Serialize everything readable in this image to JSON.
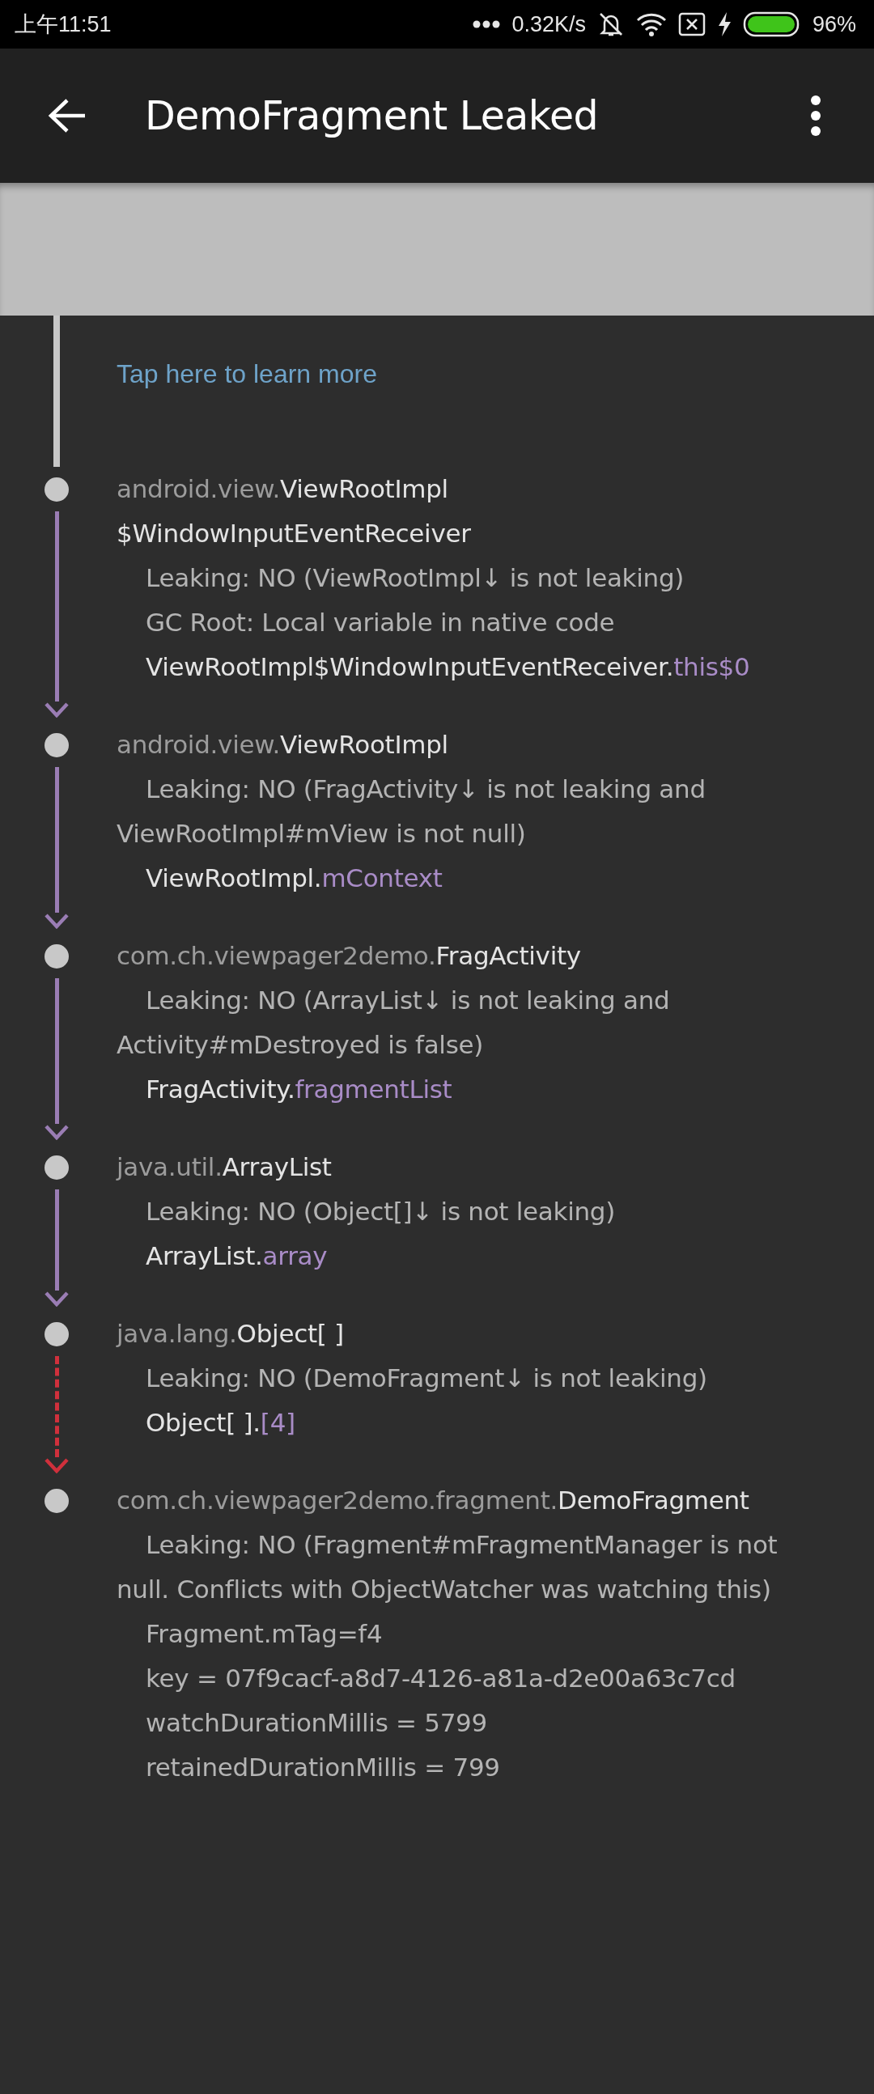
{
  "status_bar": {
    "time": "上午11:51",
    "network_speed": "0.32K/s",
    "battery_percent": "96%"
  },
  "app_bar": {
    "title": "DemoFragment Leaked"
  },
  "learn_more_link": "Tap here to learn more",
  "leak_trace": [
    {
      "arrow": {
        "kind": "reference"
      },
      "rows": [
        {
          "kind": "header",
          "segments": [
            {
              "text": "android.view.",
              "kind": "package"
            },
            {
              "text": "ViewRootImpl",
              "kind": "class"
            },
            {
              "text": "$WindowInputEventReceiver",
              "kind": "class"
            }
          ]
        },
        {
          "kind": "detail",
          "segments": [
            {
              "text": "Leaking: NO (ViewRootImpl↓  is not leaking)",
              "kind": "detail"
            }
          ]
        },
        {
          "kind": "detail",
          "segments": [
            {
              "text": "GC Root: Local variable in native code",
              "kind": "detail"
            }
          ]
        },
        {
          "kind": "reference",
          "segments": [
            {
              "text": "ViewRootImpl",
              "kind": "class"
            },
            {
              "text": "$WindowInputEventReceiver.",
              "kind": "class"
            },
            {
              "text": "this$0",
              "kind": "field"
            }
          ]
        }
      ]
    },
    {
      "arrow": {
        "kind": "reference"
      },
      "rows": [
        {
          "kind": "header",
          "segments": [
            {
              "text": "android.view.",
              "kind": "package"
            },
            {
              "text": "ViewRootImpl",
              "kind": "class"
            }
          ]
        },
        {
          "kind": "detail",
          "segments": [
            {
              "text": "Leaking: NO (FragActivity↓  is not leaking and ViewRootImpl#mView is not null)",
              "kind": "detail"
            }
          ]
        },
        {
          "kind": "reference",
          "segments": [
            {
              "text": "ViewRootImpl.",
              "kind": "class"
            },
            {
              "text": "mContext",
              "kind": "field"
            }
          ]
        }
      ]
    },
    {
      "arrow": {
        "kind": "reference"
      },
      "rows": [
        {
          "kind": "header",
          "segments": [
            {
              "text": "com.ch.viewpager2demo.",
              "kind": "package"
            },
            {
              "text": "FragActivity",
              "kind": "class"
            }
          ]
        },
        {
          "kind": "detail",
          "segments": [
            {
              "text": "Leaking: NO (ArrayList↓  is not leaking and Activity#mDestroyed is false)",
              "kind": "detail"
            }
          ]
        },
        {
          "kind": "reference",
          "segments": [
            {
              "text": "FragActivity.",
              "kind": "class"
            },
            {
              "text": "fragmentList",
              "kind": "field"
            }
          ]
        }
      ]
    },
    {
      "arrow": {
        "kind": "reference"
      },
      "rows": [
        {
          "kind": "header",
          "segments": [
            {
              "text": "java.util.",
              "kind": "package"
            },
            {
              "text": "ArrayList",
              "kind": "class"
            }
          ]
        },
        {
          "kind": "detail",
          "segments": [
            {
              "text": "Leaking: NO (Object[]↓  is not leaking)",
              "kind": "detail"
            }
          ]
        },
        {
          "kind": "reference",
          "segments": [
            {
              "text": "ArrayList.",
              "kind": "class"
            },
            {
              "text": "array",
              "kind": "field"
            }
          ]
        }
      ]
    },
    {
      "arrow": {
        "kind": "suspect"
      },
      "rows": [
        {
          "kind": "header",
          "segments": [
            {
              "text": "java.lang.",
              "kind": "package"
            },
            {
              "text": "Object[ ]",
              "kind": "class"
            }
          ]
        },
        {
          "kind": "detail",
          "segments": [
            {
              "text": "Leaking: NO (DemoFragment↓  is not leaking)",
              "kind": "detail"
            }
          ]
        },
        {
          "kind": "reference",
          "segments": [
            {
              "text": "Object[ ].",
              "kind": "class"
            },
            {
              "text": "[4]",
              "kind": "field"
            }
          ]
        }
      ]
    },
    {
      "rows": [
        {
          "kind": "header",
          "segments": [
            {
              "text": "com.ch.viewpager2demo.fragment.",
              "kind": "package"
            },
            {
              "text": "DemoFragment",
              "kind": "class"
            }
          ]
        },
        {
          "kind": "detail",
          "segments": [
            {
              "text": "Leaking: NO (Fragment#mFragmentManager is not null. Conflicts with ObjectWatcher was watching this)",
              "kind": "detail"
            }
          ]
        },
        {
          "kind": "detail",
          "segments": [
            {
              "text": "Fragment.mTag=f4",
              "kind": "detail"
            }
          ]
        },
        {
          "kind": "detail",
          "segments": [
            {
              "text": "key = 07f9cacf-a8d7-4126-a81a-d2e00a63c7cd",
              "kind": "detail"
            }
          ]
        },
        {
          "kind": "detail",
          "segments": [
            {
              "text": "watchDurationMillis = 5799",
              "kind": "detail"
            }
          ]
        },
        {
          "kind": "detail",
          "segments": [
            {
              "text": "retainedDurationMillis = 799",
              "kind": "detail"
            }
          ]
        }
      ]
    }
  ]
}
